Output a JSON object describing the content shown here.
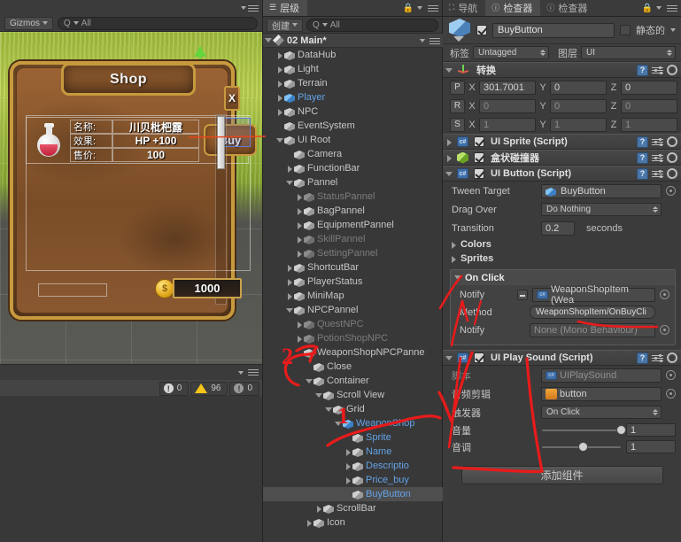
{
  "scene_view": {
    "toolbar": {
      "gizmos_label": "Gizmos",
      "search_placeholder": "All",
      "search_value": ""
    },
    "game": {
      "shop_title": "Shop",
      "close_label": "X",
      "item": {
        "rows": [
          {
            "label": "名称:",
            "value": "川贝枇杷露"
          },
          {
            "label": "效果:",
            "value": "HP +100"
          },
          {
            "label": "售价:",
            "value": "100"
          }
        ],
        "buy_label": "Buy"
      },
      "gold_value": "1000",
      "coin_glyph": "$"
    },
    "status": {
      "errors": "0",
      "warnings": "96",
      "logs": "0"
    }
  },
  "hierarchy": {
    "tab_label": "层级",
    "create_label": "创建",
    "search_placeholder": "All",
    "search_value": "",
    "scene_name": "02 Main*",
    "items": [
      {
        "label": "DataHub",
        "depth": 1,
        "arrow": "right",
        "state": "normal"
      },
      {
        "label": "Light",
        "depth": 1,
        "arrow": "right",
        "state": "normal"
      },
      {
        "label": "Terrain",
        "depth": 1,
        "arrow": "right",
        "state": "normal"
      },
      {
        "label": "Player",
        "depth": 1,
        "arrow": "right",
        "state": "blue"
      },
      {
        "label": "NPC",
        "depth": 1,
        "arrow": "right",
        "state": "normal"
      },
      {
        "label": "EventSystem",
        "depth": 1,
        "arrow": "none",
        "state": "normal"
      },
      {
        "label": "UI Root",
        "depth": 1,
        "arrow": "down",
        "state": "normal"
      },
      {
        "label": "Camera",
        "depth": 2,
        "arrow": "none",
        "state": "normal"
      },
      {
        "label": "FunctionBar",
        "depth": 2,
        "arrow": "right",
        "state": "normal"
      },
      {
        "label": "Pannel",
        "depth": 2,
        "arrow": "down",
        "state": "normal"
      },
      {
        "label": "StatusPannel",
        "depth": 3,
        "arrow": "right",
        "state": "dim"
      },
      {
        "label": "BagPannel",
        "depth": 3,
        "arrow": "right",
        "state": "normal"
      },
      {
        "label": "EquipmentPannel",
        "depth": 3,
        "arrow": "right",
        "state": "normal"
      },
      {
        "label": "SkillPannel",
        "depth": 3,
        "arrow": "right",
        "state": "dim"
      },
      {
        "label": "SettingPannel",
        "depth": 3,
        "arrow": "right",
        "state": "dim"
      },
      {
        "label": "ShortcutBar",
        "depth": 2,
        "arrow": "right",
        "state": "normal"
      },
      {
        "label": "PlayerStatus",
        "depth": 2,
        "arrow": "right",
        "state": "normal"
      },
      {
        "label": "MiniMap",
        "depth": 2,
        "arrow": "right",
        "state": "normal"
      },
      {
        "label": "NPCPannel",
        "depth": 2,
        "arrow": "down",
        "state": "normal"
      },
      {
        "label": "QuestNPC",
        "depth": 3,
        "arrow": "right",
        "state": "dim"
      },
      {
        "label": "PotionShopNPC",
        "depth": 3,
        "arrow": "right",
        "state": "dim"
      },
      {
        "label": "WeaponShopNPCPanne",
        "depth": 3,
        "arrow": "none",
        "state": "normal"
      },
      {
        "label": "Close",
        "depth": 4,
        "arrow": "none",
        "state": "normal"
      },
      {
        "label": "Container",
        "depth": 4,
        "arrow": "down",
        "state": "normal"
      },
      {
        "label": "Scroll View",
        "depth": 5,
        "arrow": "down",
        "state": "normal"
      },
      {
        "label": "Grid",
        "depth": 6,
        "arrow": "down",
        "state": "normal"
      },
      {
        "label": "WeaponShop",
        "depth": 7,
        "arrow": "down",
        "state": "blue"
      },
      {
        "label": "Sprite",
        "depth": 8,
        "arrow": "none",
        "state": "blue"
      },
      {
        "label": "Name",
        "depth": 8,
        "arrow": "right",
        "state": "blue"
      },
      {
        "label": "Descriptio",
        "depth": 8,
        "arrow": "right",
        "state": "blue"
      },
      {
        "label": "Price_buy",
        "depth": 8,
        "arrow": "right",
        "state": "blue"
      },
      {
        "label": "BuyButton",
        "depth": 8,
        "arrow": "none",
        "state": "blue",
        "selected": true
      },
      {
        "label": "ScrollBar",
        "depth": 5,
        "arrow": "right",
        "state": "normal"
      },
      {
        "label": "Icon",
        "depth": 4,
        "arrow": "right",
        "state": "normal"
      }
    ]
  },
  "inspector": {
    "tabs": [
      {
        "label": "导航",
        "active": false
      },
      {
        "label": "检查器",
        "active": true
      },
      {
        "label": "检查器",
        "active": false
      }
    ],
    "object_name": "BuyButton",
    "enabled": true,
    "static_label": "静态的",
    "tag_label": "标签",
    "tag_value": "Untagged",
    "layer_label": "图层",
    "layer_value": "UI",
    "transform": {
      "title": "转换",
      "rows": [
        {
          "btn": "P",
          "x": "301.7001",
          "y": "0",
          "z": "0",
          "dim": false
        },
        {
          "btn": "R",
          "x": "0",
          "y": "0",
          "z": "0",
          "dim": true
        },
        {
          "btn": "S",
          "x": "1",
          "y": "1",
          "z": "1",
          "dim": true
        }
      ]
    },
    "components": [
      {
        "title": "UI Sprite  (Script)",
        "icon": "cs-script-icon",
        "enabled": true,
        "expanded": false
      },
      {
        "title": "盒状碰撞器",
        "icon": "box-collider-icon",
        "enabled": true,
        "expanded": false
      }
    ],
    "ui_button": {
      "title": "UI Button  (Script)",
      "enabled": true,
      "tween_target_label": "Tween Target",
      "tween_target_value": "BuyButton",
      "drag_over_label": "Drag Over",
      "drag_over_value": "Do Nothing",
      "transition_label": "Transition",
      "transition_value": "0.2",
      "transition_unit": "seconds",
      "colors_label": "Colors",
      "sprites_label": "Sprites",
      "on_click": {
        "title": "On Click",
        "entries": [
          {
            "notify_label": "Notify",
            "notify_value": "WeaponShopItem (Wea",
            "method_label": "Method",
            "method_value": "WeaponShopItem/OnBuyCli",
            "has_object": true
          },
          {
            "notify_label": "Notify",
            "notify_value": "None (Mono Behaviour)",
            "has_object": false
          }
        ]
      }
    },
    "ui_play_sound": {
      "title": "UI Play Sound  (Script)",
      "enabled": true,
      "rows": [
        {
          "label": "脚本",
          "value": "UIPlaySound",
          "type": "object-dim"
        },
        {
          "label": "音频剪辑",
          "value": "button",
          "type": "audio"
        },
        {
          "label": "触发器",
          "value": "On Click",
          "type": "dropdown"
        }
      ],
      "sliders": [
        {
          "label": "音量",
          "value": "1",
          "pos": 100
        },
        {
          "label": "音调",
          "value": "1",
          "pos": 52
        }
      ]
    },
    "add_component_label": "添加组件"
  },
  "annotations": {
    "marker_one": "1",
    "marker_two": "2",
    "color": "#e81b1b"
  }
}
